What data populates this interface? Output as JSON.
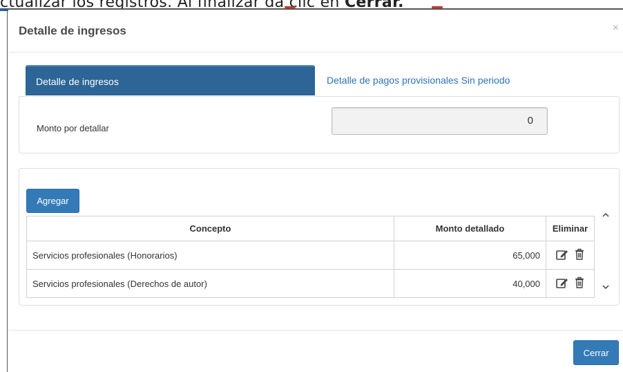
{
  "background": {
    "caption_prefix": "ctualizar los registros. Al finalizar da clic en ",
    "caption_bold": "Cerrar."
  },
  "modal": {
    "title": "Detalle de ingresos",
    "close_symbol": "×",
    "tabs": [
      {
        "label": "Detalle de ingresos",
        "active": true
      },
      {
        "label": "Detalle de pagos provisionales Sin periodo",
        "active": false
      }
    ],
    "amount": {
      "label": "Monto por detallar",
      "value": "0"
    },
    "add_button_label": "Agregar",
    "table": {
      "headers": [
        "Concepto",
        "Monto detallado",
        "Eliminar"
      ],
      "rows": [
        {
          "concepto": "Servicios profesionales (Honorarios)",
          "monto": "65,000"
        },
        {
          "concepto": "Servicios profesionales (Derechos de autor)",
          "monto": "40,000"
        }
      ]
    },
    "close_button_label": "Cerrar"
  },
  "colors": {
    "primary": "#337ab7",
    "tab_active": "#2d6596",
    "link": "#2d73b8"
  },
  "icons": {
    "edit": "edit-icon",
    "delete": "trash-icon",
    "scroll_up": "chevron-up-icon",
    "scroll_down": "chevron-down-icon"
  }
}
